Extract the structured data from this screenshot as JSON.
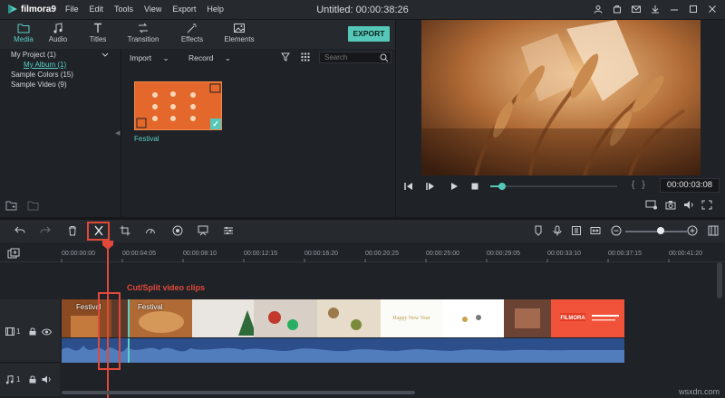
{
  "app": {
    "name": "filmora9",
    "window_title": "Untitled:  00:00:38:26",
    "menus": [
      "File",
      "Edit",
      "Tools",
      "View",
      "Export",
      "Help"
    ]
  },
  "tabs": [
    {
      "label": "Media",
      "icon": "folder-icon",
      "active": true
    },
    {
      "label": "Audio",
      "icon": "music-note-icon",
      "active": false
    },
    {
      "label": "Titles",
      "icon": "text-t-icon",
      "active": false
    },
    {
      "label": "Transition",
      "icon": "transition-icon",
      "active": false
    },
    {
      "label": "Effects",
      "icon": "effects-icon",
      "active": false
    },
    {
      "label": "Elements",
      "icon": "image-icon",
      "active": false
    }
  ],
  "export_label": "EXPORT",
  "tree": [
    {
      "label": "My Project (1)",
      "selected": false,
      "indent": false
    },
    {
      "label": "My Album (1)",
      "selected": true,
      "indent": true
    },
    {
      "label": "Sample Colors (15)",
      "selected": false,
      "indent": false
    },
    {
      "label": "Sample Video (9)",
      "selected": false,
      "indent": false
    }
  ],
  "library": {
    "import_label": "Import",
    "record_label": "Record",
    "search_placeholder": "Search",
    "thumb_label": "Festival"
  },
  "preview": {
    "time": "00:00:03:08",
    "progress": 0.07
  },
  "ruler_ticks": [
    "00:00:00:00",
    "00:00:04:05",
    "00:00:08:10",
    "00:00:12:15",
    "00:00:16:20",
    "00:00:20:25",
    "00:00:25:00",
    "00:00:29:05",
    "00:00:33:10",
    "00:00:37:15",
    "00:00:41:20"
  ],
  "annotation": "Cut/Split video clips",
  "clips": {
    "label_1": "Festival",
    "label_2": "Festival",
    "banner": "FILMORA"
  },
  "tracks": {
    "video_num": "1",
    "audio_num": "1"
  },
  "colors": {
    "accent": "#55c8b9",
    "highlight": "#e2493b",
    "background": "#1f2227",
    "panel": "#26292e"
  },
  "watermark": "wsxdn.com"
}
